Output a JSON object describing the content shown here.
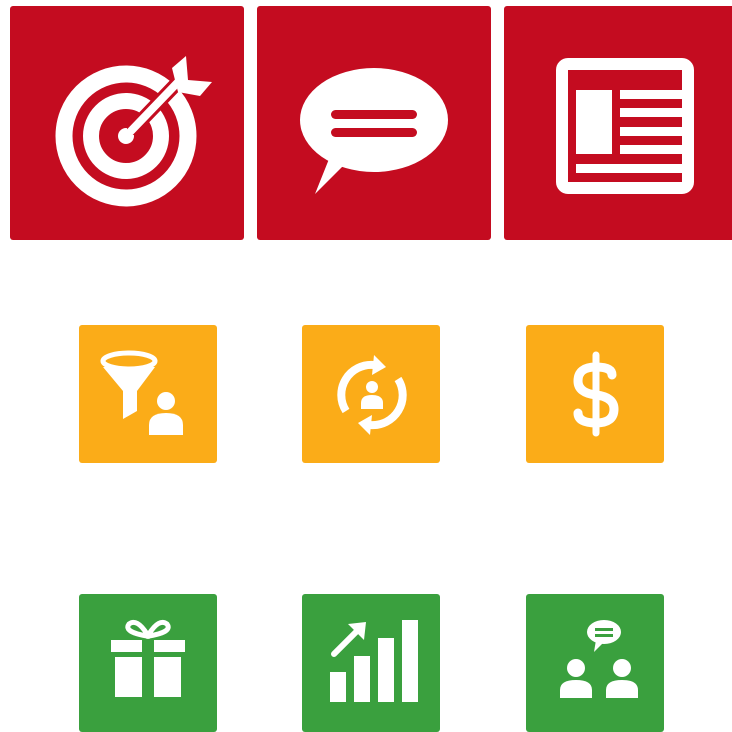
{
  "colors": {
    "red": "#c40c20",
    "orange": "#fbac18",
    "green": "#3aa03e",
    "icon": "#ffffff"
  },
  "tiles": [
    {
      "icon": "target-icon",
      "color": "red"
    },
    {
      "icon": "speech-bubble-icon",
      "color": "red"
    },
    {
      "icon": "article-layout-icon",
      "color": "red"
    },
    {
      "icon": "funnel-person-icon",
      "color": "orange"
    },
    {
      "icon": "person-cycle-icon",
      "color": "orange"
    },
    {
      "icon": "dollar-sign-icon",
      "color": "orange"
    },
    {
      "icon": "gift-box-icon",
      "color": "green"
    },
    {
      "icon": "growth-bar-chart-icon",
      "color": "green"
    },
    {
      "icon": "people-conversation-icon",
      "color": "green"
    }
  ]
}
